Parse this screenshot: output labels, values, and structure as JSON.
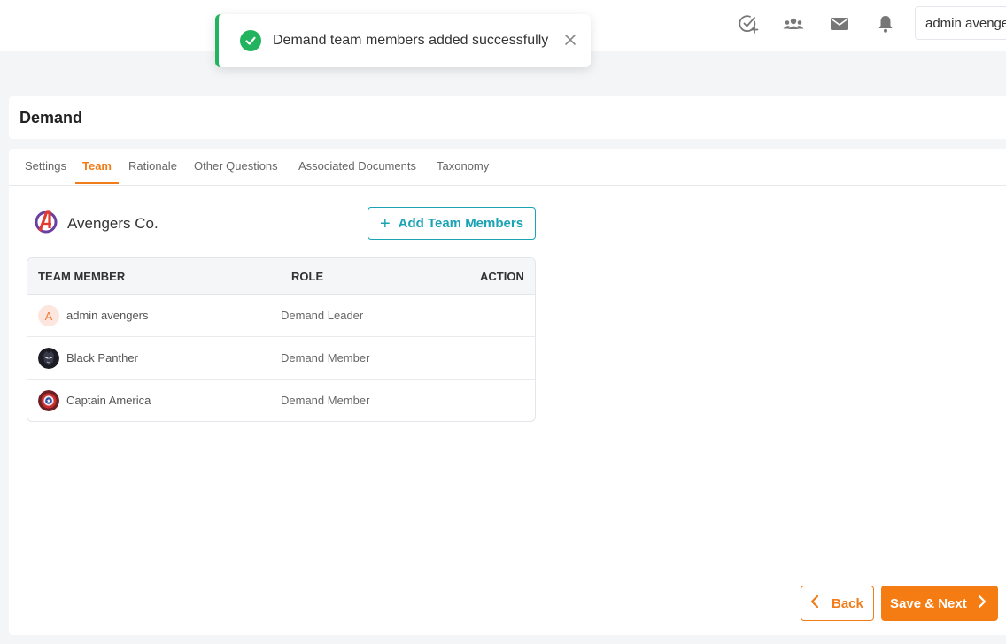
{
  "header": {
    "icons": [
      "task-check-icon",
      "team-icon",
      "mail-icon",
      "bell-icon"
    ],
    "user_name": "admin avengers"
  },
  "toast": {
    "message": "Demand team members added successfully",
    "color": "#22b35e"
  },
  "page": {
    "title": "Demand"
  },
  "tabs": [
    {
      "label": "Settings",
      "active": false
    },
    {
      "label": "Team",
      "active": true
    },
    {
      "label": "Rationale",
      "active": false
    },
    {
      "label": "Other Questions",
      "active": false
    },
    {
      "label": "Associated Documents",
      "active": false
    },
    {
      "label": "Taxonomy",
      "active": false
    }
  ],
  "organization": {
    "name": "Avengers Co."
  },
  "add_button": {
    "label": "Add Team Members"
  },
  "table": {
    "columns": [
      "TEAM MEMBER",
      "ROLE",
      "ACTION"
    ],
    "rows": [
      {
        "avatar": "A",
        "name": "admin avengers",
        "role": "Demand Leader"
      },
      {
        "avatar": "black-panther-avatar",
        "name": "Black Panther",
        "role": "Demand Member"
      },
      {
        "avatar": "captain-america-avatar",
        "name": "Captain America",
        "role": "Demand Member"
      }
    ]
  },
  "footer": {
    "back_label": "Back",
    "next_label": "Save & Next"
  },
  "colors": {
    "accent": "#f57c12",
    "teal": "#1aa3b3",
    "success": "#22b35e"
  }
}
